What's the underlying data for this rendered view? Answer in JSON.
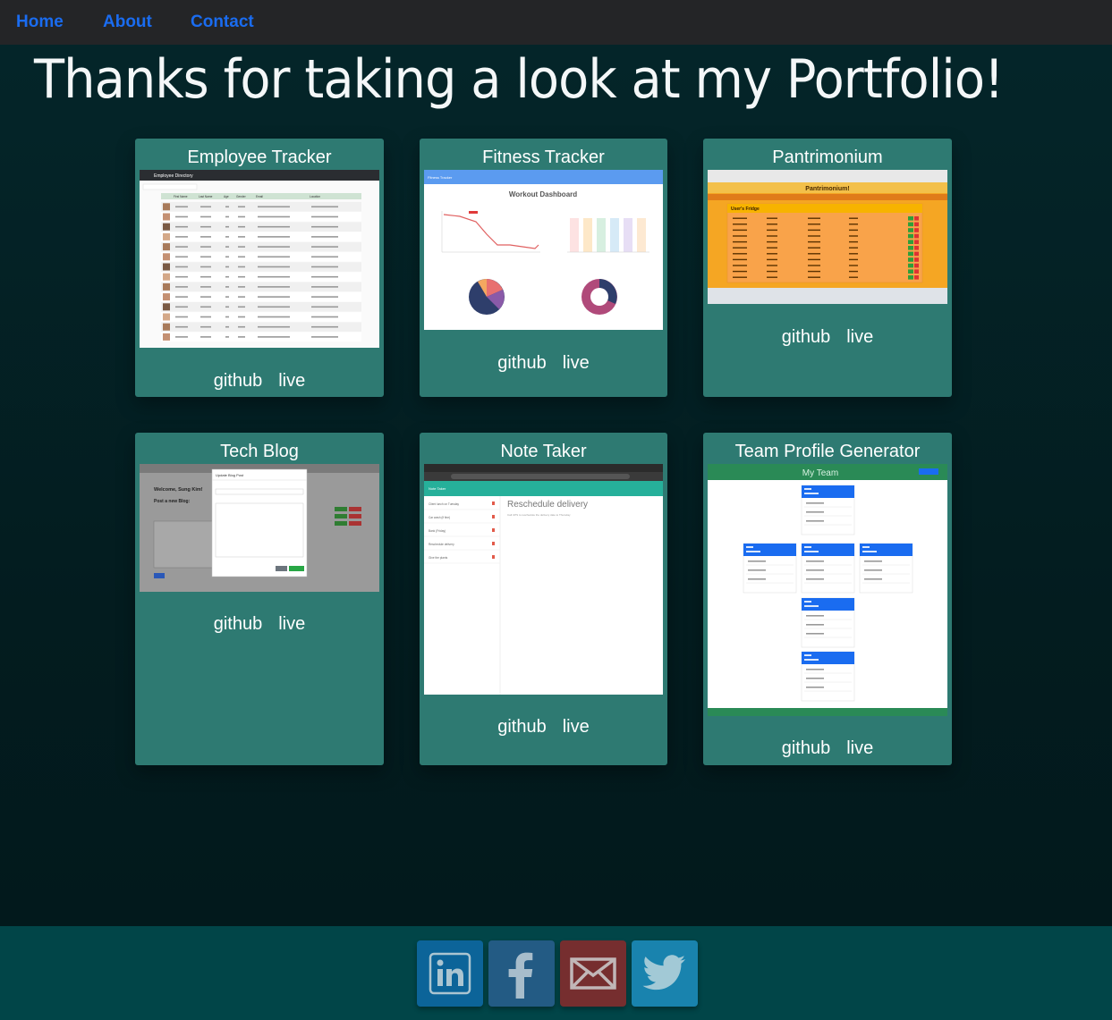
{
  "nav": {
    "items": [
      {
        "label": "Home"
      },
      {
        "label": "About"
      },
      {
        "label": "Contact"
      }
    ]
  },
  "heading": "Thanks for taking a look at my Portfolio!",
  "projects": [
    {
      "title": "Employee Tracker",
      "github": "github",
      "live": "live",
      "preview": {
        "header": "Employee Directory",
        "columns": [
          "First Name",
          "Last Name",
          "Age",
          "Gender",
          "Email",
          "Location"
        ]
      }
    },
    {
      "title": "Fitness Tracker",
      "github": "github",
      "live": "live",
      "preview": {
        "header": "Fitness Tracker",
        "dashboard": "Workout Dashboard"
      }
    },
    {
      "title": "Pantrimonium",
      "github": "github",
      "live": "live",
      "preview": {
        "banner": "Pantrimonium!",
        "panel": "User's Fridge"
      }
    },
    {
      "title": "Tech Blog",
      "github": "github",
      "live": "live",
      "preview": {
        "welcome": "Welcome, Sung Kim!",
        "post_new": "Post a new Blog:",
        "modal_title": "Update Blog Post"
      }
    },
    {
      "title": "Note Taker",
      "github": "github",
      "live": "live",
      "preview": {
        "header": "Note Taker",
        "note_title": "Reschedule delivery",
        "note_body": "Call UPS to reschedule the delivery date to Thursday",
        "notes": [
          "Client lunch on Tuesday",
          "Car wash (if fine)",
          "Bank (Friday)",
          "Reschedule delivery",
          "Give the plants"
        ]
      }
    },
    {
      "title": "Team Profile Generator",
      "github": "github",
      "live": "live",
      "preview": {
        "header": "My Team"
      }
    }
  ],
  "footer": {
    "social": [
      {
        "icon": "linkedin-icon",
        "color": "#0e6aa8"
      },
      {
        "icon": "facebook-icon",
        "color": "#2a5f8f"
      },
      {
        "icon": "email-icon",
        "color": "#8b2b2b"
      },
      {
        "icon": "twitter-icon",
        "color": "#1e8ec0"
      }
    ]
  },
  "colors": {
    "navbar": "#242527",
    "nav_link": "#1a6cf0",
    "card": "#2e7a72",
    "footer": "#014548",
    "background": "#031c1f"
  }
}
